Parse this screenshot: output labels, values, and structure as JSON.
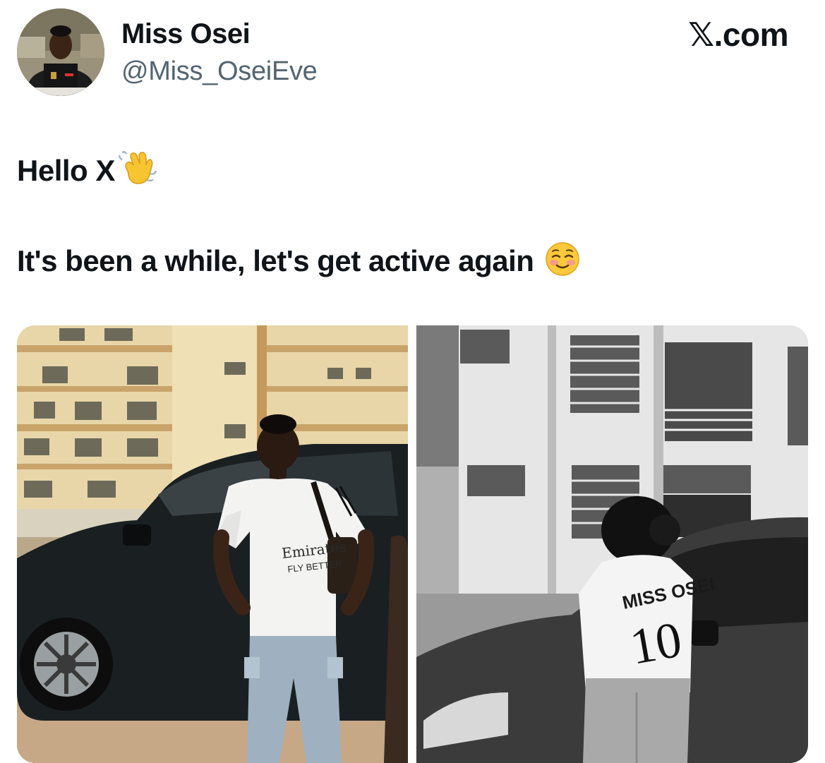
{
  "tweet": {
    "author": {
      "display_name": "Miss Osei",
      "handle": "@Miss_OseiEve",
      "avatar_icon": "profile-photo"
    },
    "brand": "𝕏.com",
    "text_line1": "Hello X",
    "text_line1_emoji": "waving-hand-emoji",
    "text_line2": "It's been a while, let's get active again",
    "text_line2_emoji": "smiling-face-emoji",
    "media": [
      {
        "style": "color",
        "shirt_front_text_1": "Emirates",
        "shirt_front_text_2": "FLY BETTER"
      },
      {
        "style": "black-and-white",
        "shirt_back_name": "MISS OSEI",
        "shirt_back_number": "10"
      }
    ]
  },
  "colors": {
    "text": "#0f1419",
    "secondary_text": "#536471",
    "background": "#ffffff"
  }
}
